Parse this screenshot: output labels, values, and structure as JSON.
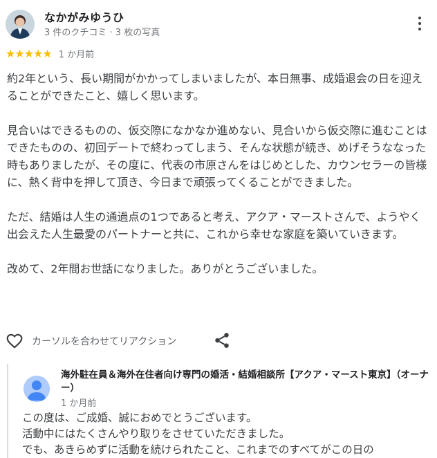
{
  "reviewer": {
    "name": "なかがみゆうひ",
    "meta": "3 件のクチコミ · 3 枚の写真"
  },
  "rating": {
    "stars": "★★★★★",
    "value": 5,
    "max": 5,
    "when": "1 か月前"
  },
  "review": {
    "paragraphs": [
      "約2年という、長い期間がかかってしまいましたが、本日無事、成婚退会の日を迎えることができたこと、嬉しく思います。",
      "見合いはできるものの、仮交際になかなか進めない、見合いから仮交際に進むことはできたものの、初回デートで終わってしまう、そんな状態が続き、めげそうななった時もありましたが、その度に、代表の市原さんをはじめとした、カウンセラーの皆様に、熱く背中を押して頂き、今日まで頑張ってくることができました。",
      "ただ、結婚は人生の通過点の1つであると考え、アクア・マーストさんで、ようやく出会えた人生最愛のパートナーと共に、これから幸せな家庭を築いていきます。",
      "改めて、2年間お世話になりました。ありがとうございました。"
    ]
  },
  "reaction": {
    "label": "カーソルを合わせてリアクション"
  },
  "owner": {
    "name": "海外駐在員＆海外在住者向け専門の婚活・結婚相談所【アクア・マースト東京】（オーナー）",
    "when": "1 か月前",
    "lines": [
      "この度は、ご成婚、誠におめでとうございます。",
      "活動中にはたくさんやり取りをさせていただきました。",
      "でも、あきらめずに活動を続けられたこと、これまでのすべてがこの日の"
    ]
  },
  "colors": {
    "star": "#fbbc04",
    "text": "#3c4043",
    "muted": "#70757a",
    "owner_avatar": "#aecbfa"
  }
}
